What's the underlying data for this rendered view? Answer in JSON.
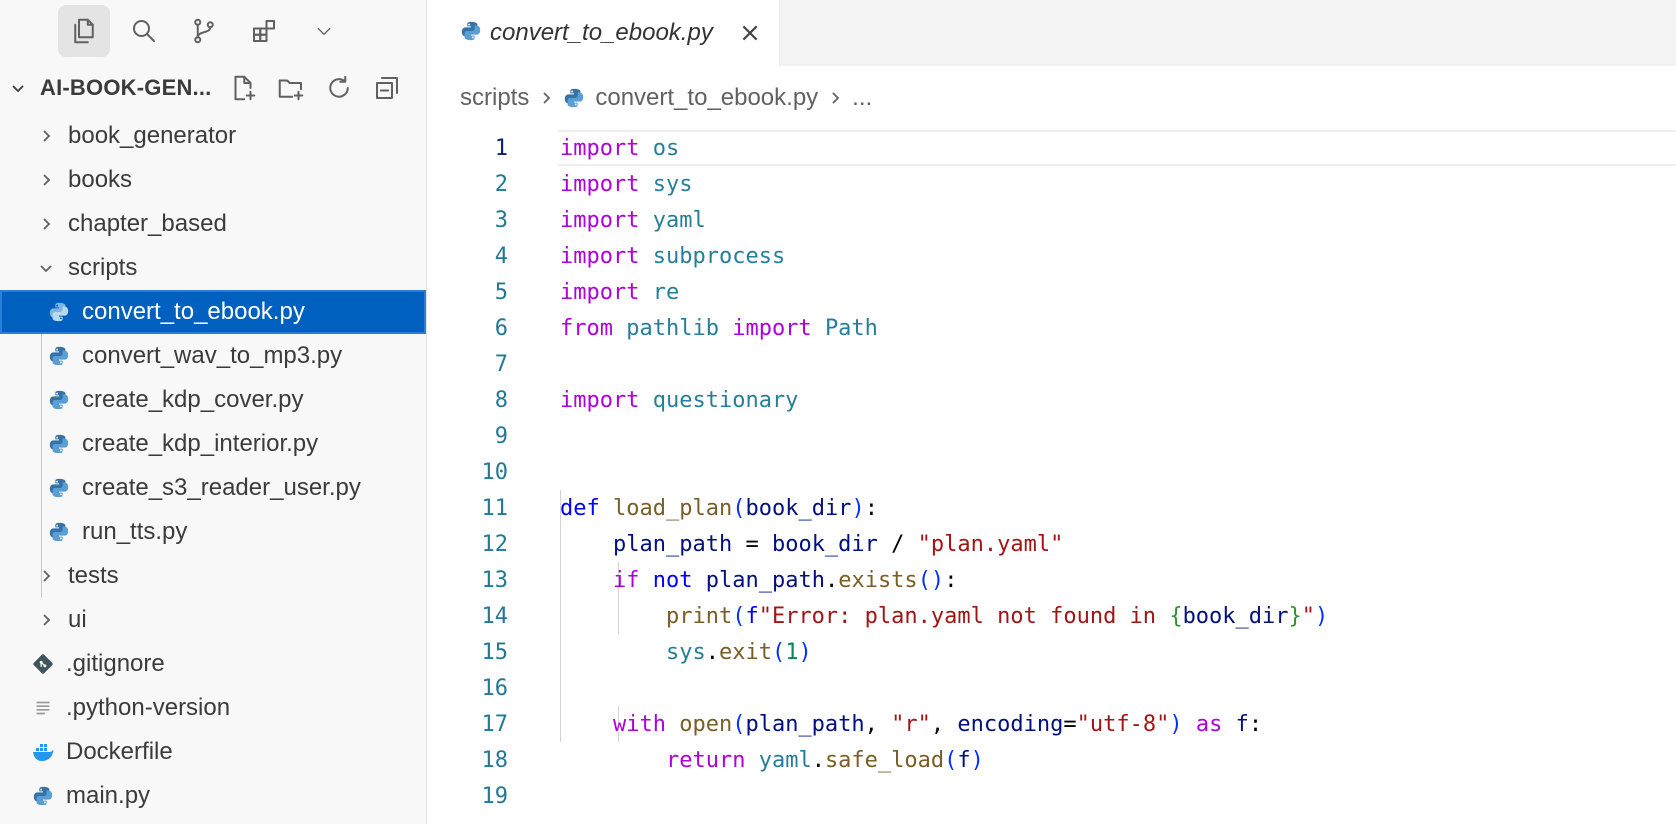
{
  "sidebar": {
    "activity": [
      {
        "name": "explorer-icon",
        "active": true
      },
      {
        "name": "search-icon",
        "active": false
      },
      {
        "name": "source-control-icon",
        "active": false
      },
      {
        "name": "extensions-icon",
        "active": false
      },
      {
        "name": "chevron-down-icon",
        "active": false
      }
    ],
    "root_name": "AI-BOOK-GEN...",
    "header_actions": [
      "new-file-icon",
      "new-folder-icon",
      "refresh-icon",
      "collapse-all-icon"
    ],
    "tree": {
      "book_generator": "book_generator",
      "books": "books",
      "chapter_based": "chapter_based",
      "scripts": "scripts",
      "scripts_files": [
        "convert_to_ebook.py",
        "convert_wav_to_mp3.py",
        "create_kdp_cover.py",
        "create_kdp_interior.py",
        "create_s3_reader_user.py",
        "run_tts.py"
      ],
      "tests": "tests",
      "ui": "ui",
      "gitignore": ".gitignore",
      "python_version": ".python-version",
      "dockerfile": "Dockerfile",
      "main": "main.py"
    },
    "selected": "convert_to_ebook.py"
  },
  "editor": {
    "tab_label": "convert_to_ebook.py",
    "breadcrumb": {
      "folder": "scripts",
      "file": "convert_to_ebook.py",
      "more": "..."
    },
    "line_numbers": [
      "1",
      "2",
      "3",
      "4",
      "5",
      "6",
      "7",
      "8",
      "9",
      "10",
      "11",
      "12",
      "13",
      "14",
      "15",
      "16",
      "17",
      "18",
      "19"
    ],
    "active_line": 1
  },
  "colors": {
    "selection": "#0060c0",
    "keyword": "#af00db",
    "def_keyword": "#0000ff",
    "module": "#267f99",
    "function": "#795e26",
    "variable": "#001080",
    "string": "#a31515",
    "number": "#098658",
    "line_number": "#237893"
  }
}
